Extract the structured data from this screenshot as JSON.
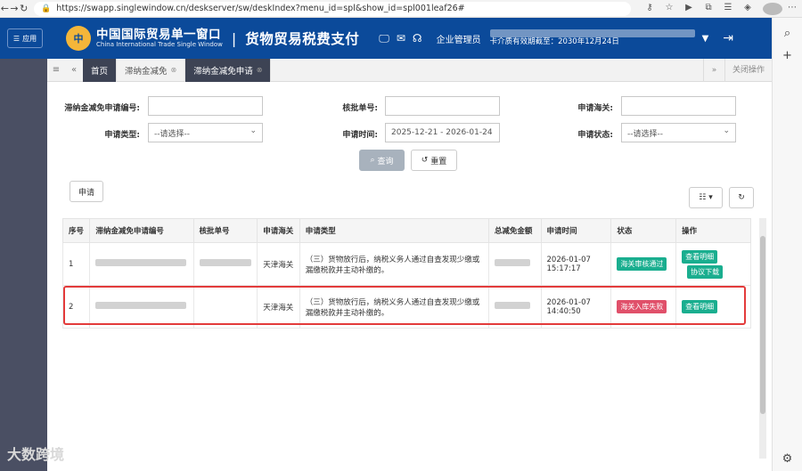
{
  "browser": {
    "url": "https://swapp.singlewindow.cn/deskserver/sw/deskIndex?menu_id=spl&show_id=spl001leaf26#"
  },
  "header": {
    "menu_label": "应用",
    "logo_text": "中",
    "brand_cn": "中国国际贸易单一窗口",
    "brand_en": "China International Trade Single Window",
    "separator": "|",
    "subtitle": "货物贸易税费支付",
    "role": "企业管理员",
    "expiry": "卡介质有效期截至：2030年12月24日"
  },
  "tabs": {
    "items": [
      {
        "label": "首页"
      },
      {
        "label": "滞纳金减免"
      },
      {
        "label": "滞纳金减免申请"
      }
    ],
    "close_ops": "关闭操作"
  },
  "search_form": {
    "app_no_label": "滞纳金减免申请编号:",
    "approval_no_label": "核批单号:",
    "customs_label": "申请海关:",
    "type_label": "申请类型:",
    "type_value": "--请选择--",
    "time_label": "申请时间:",
    "time_value": "2025-12-21 - 2026-01-24",
    "status_label": "申请状态:",
    "status_value": "--请选择--",
    "query_btn": "查询",
    "reset_btn": "重置",
    "apply_btn": "申请"
  },
  "table": {
    "headers": [
      "序号",
      "滞纳金减免申请编号",
      "核批单号",
      "申请海关",
      "申请类型",
      "总减免金额",
      "申请时间",
      "状态",
      "操作"
    ],
    "rows": [
      {
        "index": "1",
        "customs": "天津海关",
        "type": "（三）货物放行后，纳税义务人通过自查发现少缴或漏缴税款并主动补缴的。",
        "time_date": "2026-01-07",
        "time_clock": "15:17:17",
        "status": "海关审核通过",
        "op1": "查看明细",
        "op2": "协议下载"
      },
      {
        "index": "2",
        "customs": "天津海关",
        "type": "（三）货物放行后，纳税义务人通过自查发现少缴或漏缴税款并主动补缴的。",
        "time_date": "2026-01-07",
        "time_clock": "14:40:50",
        "status": "海关入库失败",
        "op1": "查看明细"
      }
    ]
  },
  "watermark": "大数跨境"
}
